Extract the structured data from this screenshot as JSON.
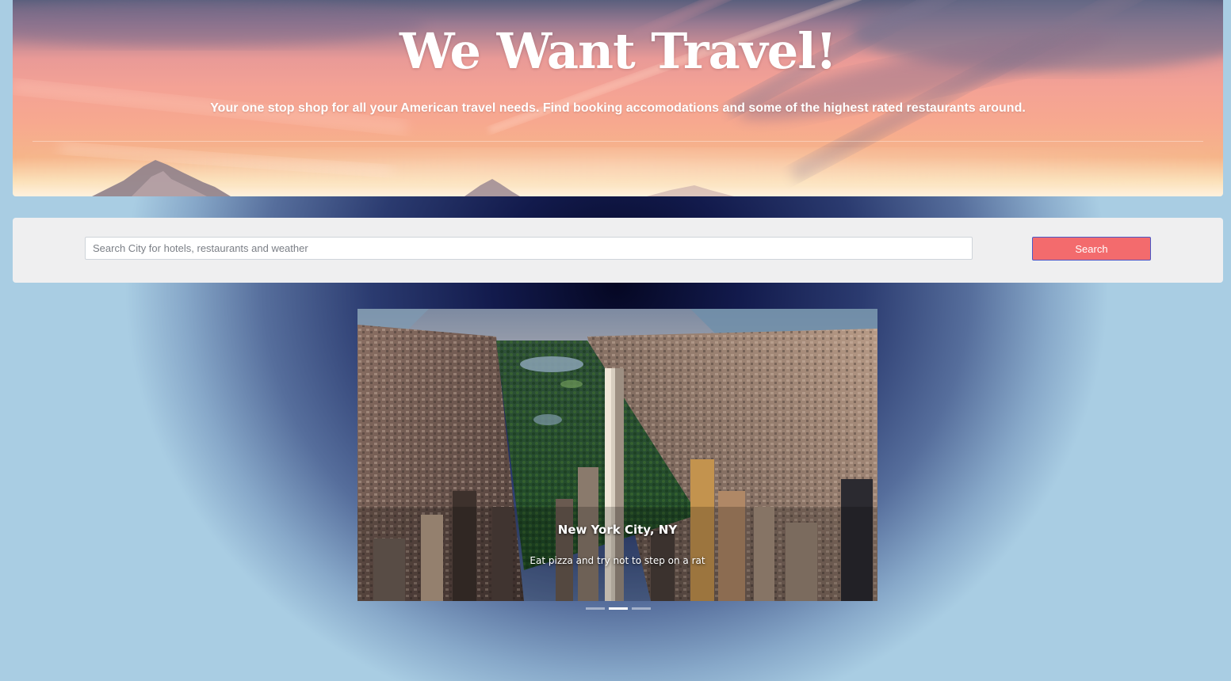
{
  "hero": {
    "title": "We Want Travel!",
    "tagline": "Your one stop shop for all your American travel needs. Find booking accomodations and some of the highest rated restaurants around."
  },
  "search": {
    "placeholder": "Search City for hotels, restaurants and weather",
    "value": "",
    "button_label": "Search"
  },
  "carousel": {
    "active_index": 1,
    "slide_count": 3,
    "active_slide": {
      "title": "New York City, NY",
      "caption": "Eat pizza and try not to step on a rat"
    }
  },
  "colors": {
    "search_button": "#f36b6d",
    "search_button_border": "#4a57c8",
    "search_panel": "#efeff0"
  }
}
